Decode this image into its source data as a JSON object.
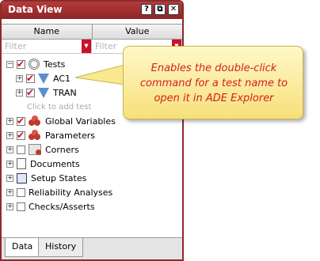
{
  "panel": {
    "title": "Data View",
    "buttons": [
      {
        "name": "help-button",
        "glyph": "?"
      },
      {
        "name": "float-button",
        "glyph": "⧉"
      },
      {
        "name": "close-button",
        "glyph": "✕"
      }
    ]
  },
  "columns": {
    "name": "Name",
    "value": "Value"
  },
  "filters": {
    "name_placeholder": "Filter",
    "value_placeholder": "Filter"
  },
  "tree": {
    "tests": "Tests",
    "test_items": [
      "AC1",
      "TRAN"
    ],
    "add_test": "Click to add test",
    "global_variables": "Global Variables",
    "parameters": "Parameters",
    "corners": "Corners",
    "documents": "Documents",
    "setup_states": "Setup States",
    "reliability": "Reliability Analyses",
    "checks": "Checks/Asserts"
  },
  "tabs": {
    "data": "Data",
    "history": "History"
  },
  "callout": {
    "text": "Enables the double-click command for a test name to open it in ADE Explorer"
  },
  "colors": {
    "accent": "#8a2b2b",
    "check": "#c8102e",
    "callout_text": "#d22020"
  }
}
